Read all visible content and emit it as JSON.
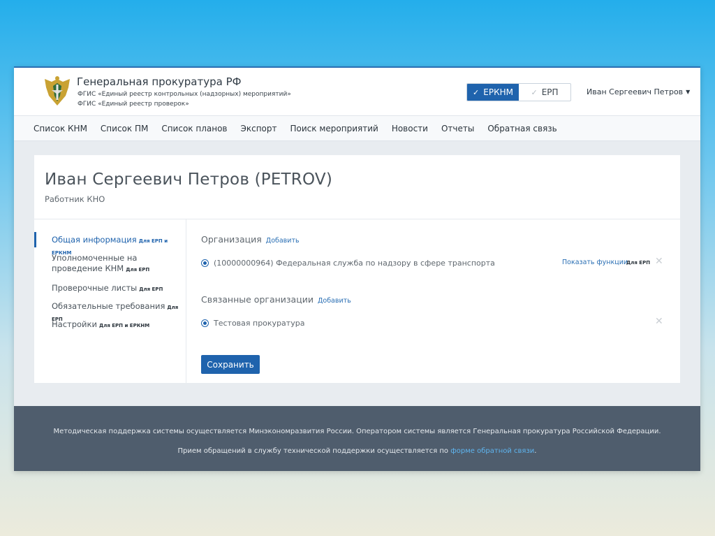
{
  "header": {
    "org_title": "Генеральная прокуратура РФ",
    "org_subtitle_1": "ФГИС «Единый реестр контрольных (надзорных) мероприятий»",
    "org_subtitle_2": "ФГИС «Единый реестр проверок»",
    "toggle": [
      {
        "label": "ЕРКНМ",
        "active": true
      },
      {
        "label": "ЕРП",
        "active": false
      }
    ],
    "user_name": "Иван Сергеевич Петров",
    "accent_color": "#1f63ad"
  },
  "nav": {
    "items": [
      "Список КНМ",
      "Список ПМ",
      "Список планов",
      "Экспорт",
      "Поиск мероприятий",
      "Новости",
      "Отчеты",
      "Обратная связь"
    ]
  },
  "profile": {
    "name": "Иван Сергеевич Петров (PETROV)",
    "role": "Работник КНО"
  },
  "sidebar": {
    "items": [
      {
        "label": "Общая информация",
        "tag": "Для ЕРП и ЕРКНМ"
      },
      {
        "label": "Уполномоченные на проведение КНМ",
        "tag": "Для ЕРП"
      },
      {
        "label": "Проверочные листы",
        "tag": "Для ЕРП"
      },
      {
        "label": "Обязательные требования",
        "tag": "Для ЕРП"
      },
      {
        "label": "Настройки",
        "tag": "Для ЕРП и ЕРКНМ"
      }
    ]
  },
  "organization": {
    "title": "Организация",
    "add_label": "Добавить",
    "item_label": "(10000000964) Федеральная служба по надзору в сфере транспорта",
    "functions_link": "Показать функции",
    "functions_tag": "Для ЕРП"
  },
  "related": {
    "title": "Связанные организации",
    "add_label": "Добавить",
    "item_label": "Тестовая прокуратура"
  },
  "save_label": "Сохранить",
  "footer": {
    "line1": "Методическая поддержка системы осуществляется Минэкономразвития России. Оператором системы является Генеральная прокуратура Российской Федерации.",
    "line2_prefix": "Прием обращений в службу технической поддержки осуществляется по ",
    "line2_link": "форме обратной связи",
    "line2_suffix": "."
  }
}
